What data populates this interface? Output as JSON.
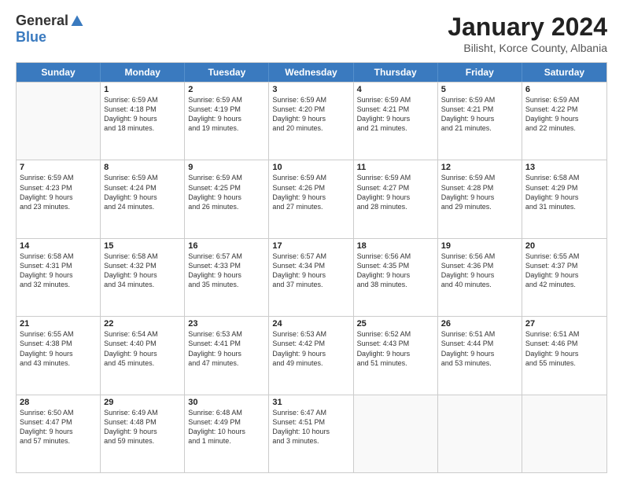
{
  "header": {
    "logo_general": "General",
    "logo_blue": "Blue",
    "month_title": "January 2024",
    "subtitle": "Bilisht, Korce County, Albania"
  },
  "days_of_week": [
    "Sunday",
    "Monday",
    "Tuesday",
    "Wednesday",
    "Thursday",
    "Friday",
    "Saturday"
  ],
  "weeks": [
    [
      {
        "day": "",
        "lines": []
      },
      {
        "day": "1",
        "lines": [
          "Sunrise: 6:59 AM",
          "Sunset: 4:18 PM",
          "Daylight: 9 hours",
          "and 18 minutes."
        ]
      },
      {
        "day": "2",
        "lines": [
          "Sunrise: 6:59 AM",
          "Sunset: 4:19 PM",
          "Daylight: 9 hours",
          "and 19 minutes."
        ]
      },
      {
        "day": "3",
        "lines": [
          "Sunrise: 6:59 AM",
          "Sunset: 4:20 PM",
          "Daylight: 9 hours",
          "and 20 minutes."
        ]
      },
      {
        "day": "4",
        "lines": [
          "Sunrise: 6:59 AM",
          "Sunset: 4:21 PM",
          "Daylight: 9 hours",
          "and 21 minutes."
        ]
      },
      {
        "day": "5",
        "lines": [
          "Sunrise: 6:59 AM",
          "Sunset: 4:21 PM",
          "Daylight: 9 hours",
          "and 21 minutes."
        ]
      },
      {
        "day": "6",
        "lines": [
          "Sunrise: 6:59 AM",
          "Sunset: 4:22 PM",
          "Daylight: 9 hours",
          "and 22 minutes."
        ]
      }
    ],
    [
      {
        "day": "7",
        "lines": [
          "Sunrise: 6:59 AM",
          "Sunset: 4:23 PM",
          "Daylight: 9 hours",
          "and 23 minutes."
        ]
      },
      {
        "day": "8",
        "lines": [
          "Sunrise: 6:59 AM",
          "Sunset: 4:24 PM",
          "Daylight: 9 hours",
          "and 24 minutes."
        ]
      },
      {
        "day": "9",
        "lines": [
          "Sunrise: 6:59 AM",
          "Sunset: 4:25 PM",
          "Daylight: 9 hours",
          "and 26 minutes."
        ]
      },
      {
        "day": "10",
        "lines": [
          "Sunrise: 6:59 AM",
          "Sunset: 4:26 PM",
          "Daylight: 9 hours",
          "and 27 minutes."
        ]
      },
      {
        "day": "11",
        "lines": [
          "Sunrise: 6:59 AM",
          "Sunset: 4:27 PM",
          "Daylight: 9 hours",
          "and 28 minutes."
        ]
      },
      {
        "day": "12",
        "lines": [
          "Sunrise: 6:59 AM",
          "Sunset: 4:28 PM",
          "Daylight: 9 hours",
          "and 29 minutes."
        ]
      },
      {
        "day": "13",
        "lines": [
          "Sunrise: 6:58 AM",
          "Sunset: 4:29 PM",
          "Daylight: 9 hours",
          "and 31 minutes."
        ]
      }
    ],
    [
      {
        "day": "14",
        "lines": [
          "Sunrise: 6:58 AM",
          "Sunset: 4:31 PM",
          "Daylight: 9 hours",
          "and 32 minutes."
        ]
      },
      {
        "day": "15",
        "lines": [
          "Sunrise: 6:58 AM",
          "Sunset: 4:32 PM",
          "Daylight: 9 hours",
          "and 34 minutes."
        ]
      },
      {
        "day": "16",
        "lines": [
          "Sunrise: 6:57 AM",
          "Sunset: 4:33 PM",
          "Daylight: 9 hours",
          "and 35 minutes."
        ]
      },
      {
        "day": "17",
        "lines": [
          "Sunrise: 6:57 AM",
          "Sunset: 4:34 PM",
          "Daylight: 9 hours",
          "and 37 minutes."
        ]
      },
      {
        "day": "18",
        "lines": [
          "Sunrise: 6:56 AM",
          "Sunset: 4:35 PM",
          "Daylight: 9 hours",
          "and 38 minutes."
        ]
      },
      {
        "day": "19",
        "lines": [
          "Sunrise: 6:56 AM",
          "Sunset: 4:36 PM",
          "Daylight: 9 hours",
          "and 40 minutes."
        ]
      },
      {
        "day": "20",
        "lines": [
          "Sunrise: 6:55 AM",
          "Sunset: 4:37 PM",
          "Daylight: 9 hours",
          "and 42 minutes."
        ]
      }
    ],
    [
      {
        "day": "21",
        "lines": [
          "Sunrise: 6:55 AM",
          "Sunset: 4:38 PM",
          "Daylight: 9 hours",
          "and 43 minutes."
        ]
      },
      {
        "day": "22",
        "lines": [
          "Sunrise: 6:54 AM",
          "Sunset: 4:40 PM",
          "Daylight: 9 hours",
          "and 45 minutes."
        ]
      },
      {
        "day": "23",
        "lines": [
          "Sunrise: 6:53 AM",
          "Sunset: 4:41 PM",
          "Daylight: 9 hours",
          "and 47 minutes."
        ]
      },
      {
        "day": "24",
        "lines": [
          "Sunrise: 6:53 AM",
          "Sunset: 4:42 PM",
          "Daylight: 9 hours",
          "and 49 minutes."
        ]
      },
      {
        "day": "25",
        "lines": [
          "Sunrise: 6:52 AM",
          "Sunset: 4:43 PM",
          "Daylight: 9 hours",
          "and 51 minutes."
        ]
      },
      {
        "day": "26",
        "lines": [
          "Sunrise: 6:51 AM",
          "Sunset: 4:44 PM",
          "Daylight: 9 hours",
          "and 53 minutes."
        ]
      },
      {
        "day": "27",
        "lines": [
          "Sunrise: 6:51 AM",
          "Sunset: 4:46 PM",
          "Daylight: 9 hours",
          "and 55 minutes."
        ]
      }
    ],
    [
      {
        "day": "28",
        "lines": [
          "Sunrise: 6:50 AM",
          "Sunset: 4:47 PM",
          "Daylight: 9 hours",
          "and 57 minutes."
        ]
      },
      {
        "day": "29",
        "lines": [
          "Sunrise: 6:49 AM",
          "Sunset: 4:48 PM",
          "Daylight: 9 hours",
          "and 59 minutes."
        ]
      },
      {
        "day": "30",
        "lines": [
          "Sunrise: 6:48 AM",
          "Sunset: 4:49 PM",
          "Daylight: 10 hours",
          "and 1 minute."
        ]
      },
      {
        "day": "31",
        "lines": [
          "Sunrise: 6:47 AM",
          "Sunset: 4:51 PM",
          "Daylight: 10 hours",
          "and 3 minutes."
        ]
      },
      {
        "day": "",
        "lines": []
      },
      {
        "day": "",
        "lines": []
      },
      {
        "day": "",
        "lines": []
      }
    ]
  ]
}
